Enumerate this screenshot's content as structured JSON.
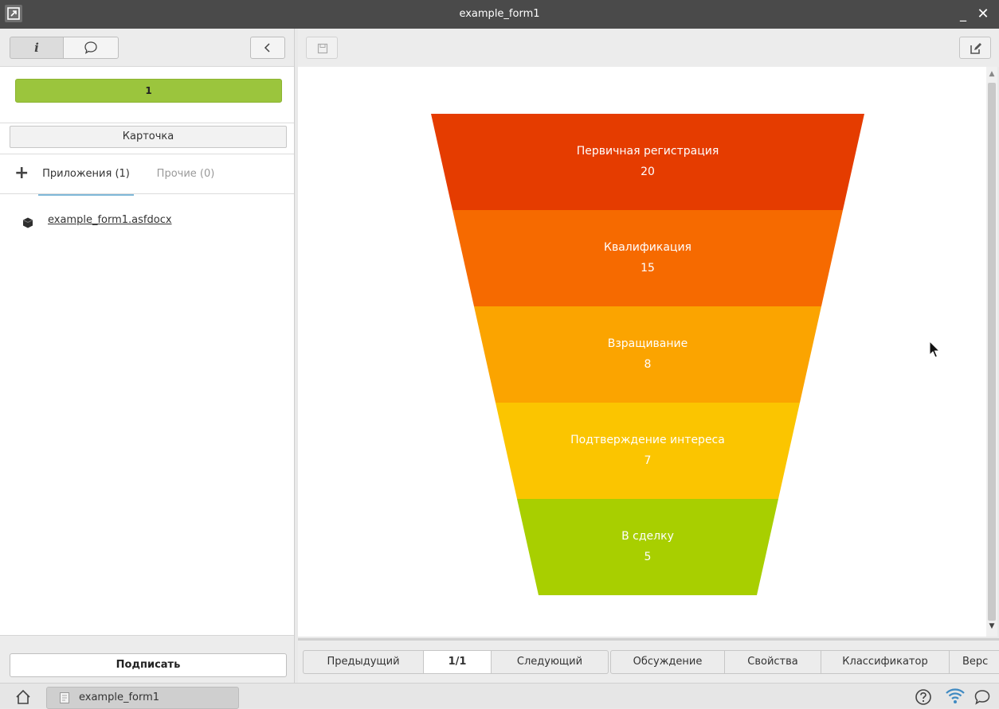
{
  "window": {
    "title": "example_form1",
    "minimize_label": "_",
    "close_label": "✕"
  },
  "sidebar": {
    "status_value": "1",
    "card_button": "Карточка",
    "tabs": {
      "attachments": "Приложения (1)",
      "other": "Прочие (0)"
    },
    "attachment_file": "example_form1.asfdocx",
    "sign_button": "Подписать"
  },
  "chart_data": {
    "type": "funnel",
    "stages": [
      {
        "label": "Первичная регистрация",
        "value": "20",
        "color": "#e53c00"
      },
      {
        "label": "Квалификация",
        "value": "15",
        "color": "#f66a00"
      },
      {
        "label": "Взращивание",
        "value": "8",
        "color": "#fba400"
      },
      {
        "label": "Подтверждение интереса",
        "value": "7",
        "color": "#fbc500"
      },
      {
        "label": "В сделку",
        "value": "5",
        "color": "#a8cf00"
      }
    ]
  },
  "nav": {
    "prev": "Предыдущий",
    "page": "1/1",
    "next": "Следующий",
    "discussion": "Обсуждение",
    "properties": "Свойства",
    "classifier": "Классификатор",
    "versions": "Верс"
  },
  "taskbar": {
    "task_label": "example_form1"
  },
  "colors": {
    "status_green": "#9bc53d",
    "tab_underline": "#7fb8d8",
    "titlebar": "#4a4a4a"
  },
  "icons": [
    "home-icon",
    "help-icon",
    "wifi-icon",
    "chat-icon",
    "info-icon",
    "comment-icon",
    "chevron-left-icon",
    "save-icon",
    "edit-icon",
    "plus-icon",
    "file-icon",
    "cursor-icon"
  ]
}
